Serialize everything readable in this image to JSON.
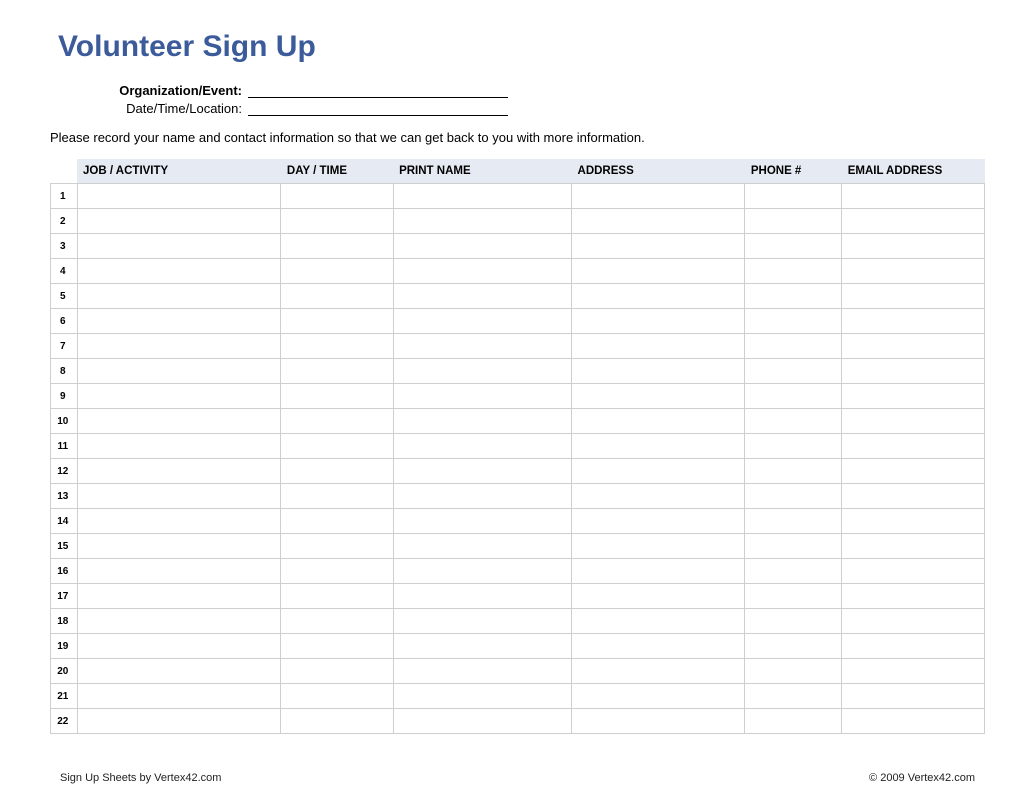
{
  "title": "Volunteer Sign Up",
  "meta": {
    "organization_label": "Organization/Event:",
    "datetime_label": "Date/Time/Location:",
    "organization_value": "",
    "datetime_value": ""
  },
  "instructions": "Please record your name and contact information so that we can get back to you with more information.",
  "columns": {
    "job": "JOB / ACTIVITY",
    "day": "DAY / TIME",
    "name": "PRINT NAME",
    "address": "ADDRESS",
    "phone": "PHONE #",
    "email": "EMAIL ADDRESS"
  },
  "rows": [
    {
      "n": "1",
      "job": "",
      "day": "",
      "name": "",
      "address": "",
      "phone": "",
      "email": ""
    },
    {
      "n": "2",
      "job": "",
      "day": "",
      "name": "",
      "address": "",
      "phone": "",
      "email": ""
    },
    {
      "n": "3",
      "job": "",
      "day": "",
      "name": "",
      "address": "",
      "phone": "",
      "email": ""
    },
    {
      "n": "4",
      "job": "",
      "day": "",
      "name": "",
      "address": "",
      "phone": "",
      "email": ""
    },
    {
      "n": "5",
      "job": "",
      "day": "",
      "name": "",
      "address": "",
      "phone": "",
      "email": ""
    },
    {
      "n": "6",
      "job": "",
      "day": "",
      "name": "",
      "address": "",
      "phone": "",
      "email": ""
    },
    {
      "n": "7",
      "job": "",
      "day": "",
      "name": "",
      "address": "",
      "phone": "",
      "email": ""
    },
    {
      "n": "8",
      "job": "",
      "day": "",
      "name": "",
      "address": "",
      "phone": "",
      "email": ""
    },
    {
      "n": "9",
      "job": "",
      "day": "",
      "name": "",
      "address": "",
      "phone": "",
      "email": ""
    },
    {
      "n": "10",
      "job": "",
      "day": "",
      "name": "",
      "address": "",
      "phone": "",
      "email": ""
    },
    {
      "n": "11",
      "job": "",
      "day": "",
      "name": "",
      "address": "",
      "phone": "",
      "email": ""
    },
    {
      "n": "12",
      "job": "",
      "day": "",
      "name": "",
      "address": "",
      "phone": "",
      "email": ""
    },
    {
      "n": "13",
      "job": "",
      "day": "",
      "name": "",
      "address": "",
      "phone": "",
      "email": ""
    },
    {
      "n": "14",
      "job": "",
      "day": "",
      "name": "",
      "address": "",
      "phone": "",
      "email": ""
    },
    {
      "n": "15",
      "job": "",
      "day": "",
      "name": "",
      "address": "",
      "phone": "",
      "email": ""
    },
    {
      "n": "16",
      "job": "",
      "day": "",
      "name": "",
      "address": "",
      "phone": "",
      "email": ""
    },
    {
      "n": "17",
      "job": "",
      "day": "",
      "name": "",
      "address": "",
      "phone": "",
      "email": ""
    },
    {
      "n": "18",
      "job": "",
      "day": "",
      "name": "",
      "address": "",
      "phone": "",
      "email": ""
    },
    {
      "n": "19",
      "job": "",
      "day": "",
      "name": "",
      "address": "",
      "phone": "",
      "email": ""
    },
    {
      "n": "20",
      "job": "",
      "day": "",
      "name": "",
      "address": "",
      "phone": "",
      "email": ""
    },
    {
      "n": "21",
      "job": "",
      "day": "",
      "name": "",
      "address": "",
      "phone": "",
      "email": ""
    },
    {
      "n": "22",
      "job": "",
      "day": "",
      "name": "",
      "address": "",
      "phone": "",
      "email": ""
    }
  ],
  "footer": {
    "left": "Sign Up Sheets by Vertex42.com",
    "right": "© 2009 Vertex42.com"
  }
}
